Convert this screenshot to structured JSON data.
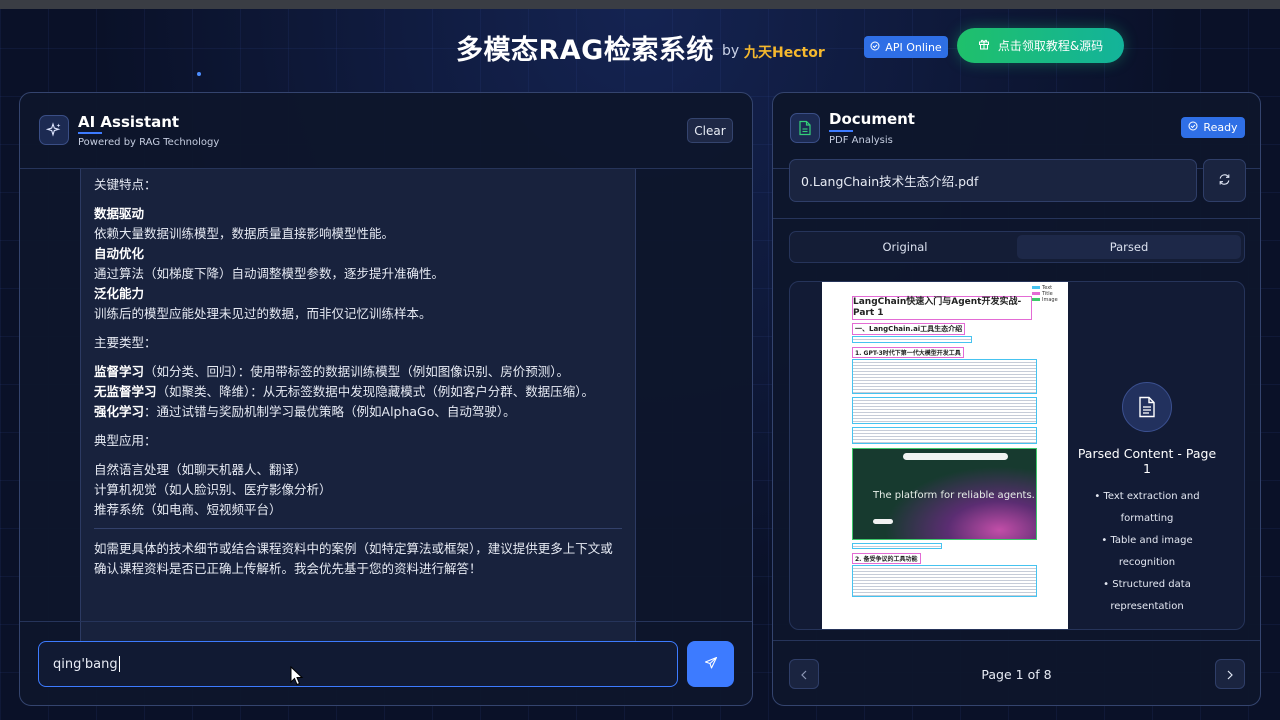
{
  "header": {
    "title": "多模态RAG检索系统",
    "by": "by",
    "author": "九天Hector",
    "api_status": "API Online",
    "tutorial_button": "点击领取教程&源码"
  },
  "chat": {
    "title": "AI Assistant",
    "subtitle": "Powered by RAG Technology",
    "clear_label": "Clear",
    "message": {
      "key_features_heading": "关键特点：",
      "features": [
        {
          "name": "数据驱动",
          "desc": "依赖大量数据训练模型，数据质量直接影响模型性能。"
        },
        {
          "name": "自动优化",
          "desc": "通过算法（如梯度下降）自动调整模型参数，逐步提升准确性。"
        },
        {
          "name": "泛化能力",
          "desc": "训练后的模型应能处理未见过的数据，而非仅记忆训练样本。"
        }
      ],
      "types_heading": "主要类型：",
      "types": [
        {
          "name": "监督学习",
          "desc": "（如分类、回归）：使用带标签的数据训练模型（例如图像识别、房价预测）。"
        },
        {
          "name": "无监督学习",
          "desc": "（如聚类、降维）：从无标签数据中发现隐藏模式（例如客户分群、数据压缩）。"
        },
        {
          "name": "强化学习",
          "desc": "：通过试错与奖励机制学习最优策略（例如AlphaGo、自动驾驶）。"
        }
      ],
      "apps_heading": "典型应用：",
      "apps": [
        "自然语言处理（如聊天机器人、翻译）",
        "计算机视觉（如人脸识别、医疗影像分析）",
        "推荐系统（如电商、短视频平台）"
      ],
      "closing": "如需更具体的技术细节或结合课程资料中的案例（如特定算法或框架），建议提供更多上下文或确认课程资料是否已正确上传解析。我会优先基于您的资料进行解答！"
    },
    "input_value": "qing'bang"
  },
  "document": {
    "title": "Document",
    "subtitle": "PDF Analysis",
    "status": "Ready",
    "file_name": "0.LangChain技术生态介绍.pdf",
    "tabs": [
      "Original",
      "Parsed"
    ],
    "active_tab": "Parsed",
    "pdf_preview": {
      "legend": [
        "Text",
        "Title",
        "Image"
      ],
      "heading": "LangChain快速入门与Agent开发实战-Part 1",
      "section1": "一、LangChain.ai工具生态介绍",
      "section2": "1. GPT-3时代下第一代大模型开发工具",
      "image_text": "The platform for reliable agents.",
      "section3": "2. 备受争议的工具功能"
    },
    "parsed": {
      "title": "Parsed Content - Page 1",
      "items": [
        "Text extraction and formatting",
        "Table and image recognition",
        "Structured data representation"
      ]
    },
    "page_indicator": "Page 1 of 8"
  },
  "colors": {
    "accent": "#3d7bff",
    "success": "#1fc06b",
    "author": "#f5b82e",
    "background": "#0a1128"
  }
}
